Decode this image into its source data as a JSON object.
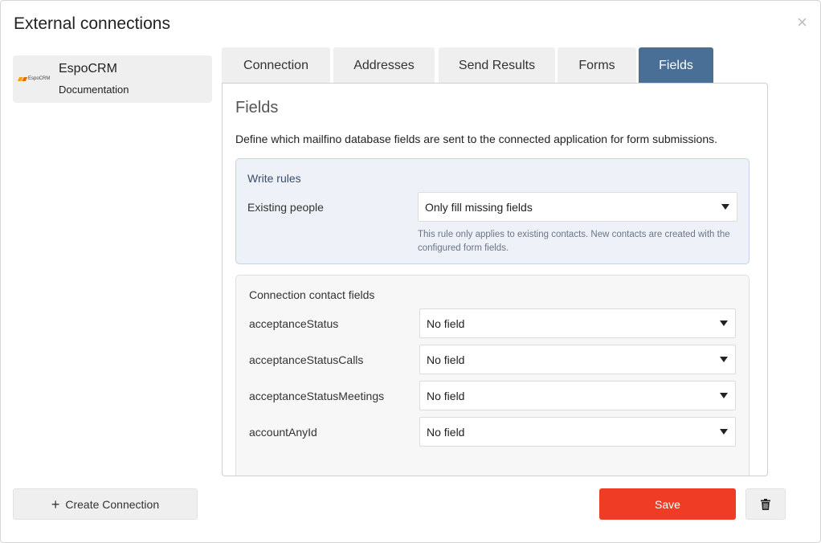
{
  "dialog": {
    "title": "External connections",
    "close_icon": "close-icon"
  },
  "connections": [
    {
      "logo_text": "EspoCRM",
      "name": "EspoCRM",
      "doc_link": "Documentation"
    }
  ],
  "tabs": [
    {
      "label": "Connection",
      "active": false
    },
    {
      "label": "Addresses",
      "active": false
    },
    {
      "label": "Send Results",
      "active": false
    },
    {
      "label": "Forms",
      "active": false
    },
    {
      "label": "Fields",
      "active": true
    }
  ],
  "fields_panel": {
    "title": "Fields",
    "description": "Define which mailfino database fields are sent to the connected application for form submissions.",
    "write_rules": {
      "title": "Write rules",
      "existing_people_label": "Existing people",
      "existing_people_value": "Only fill missing fields",
      "hint": "This rule only applies to existing contacts. New contacts are created with the configured form fields."
    },
    "contact_fields": {
      "title": "Connection contact fields",
      "rows": [
        {
          "label": "acceptanceStatus",
          "value": "No field"
        },
        {
          "label": "acceptanceStatusCalls",
          "value": "No field"
        },
        {
          "label": "acceptanceStatusMeetings",
          "value": "No field"
        },
        {
          "label": "accountAnyId",
          "value": "No field"
        }
      ]
    }
  },
  "footer": {
    "create_label": "Create Connection",
    "save_label": "Save",
    "trash_icon": "trash-icon"
  },
  "colors": {
    "active_tab": "#4a6f97",
    "save_button": "#ee3c25",
    "write_rules_bg": "#eef2f8"
  }
}
